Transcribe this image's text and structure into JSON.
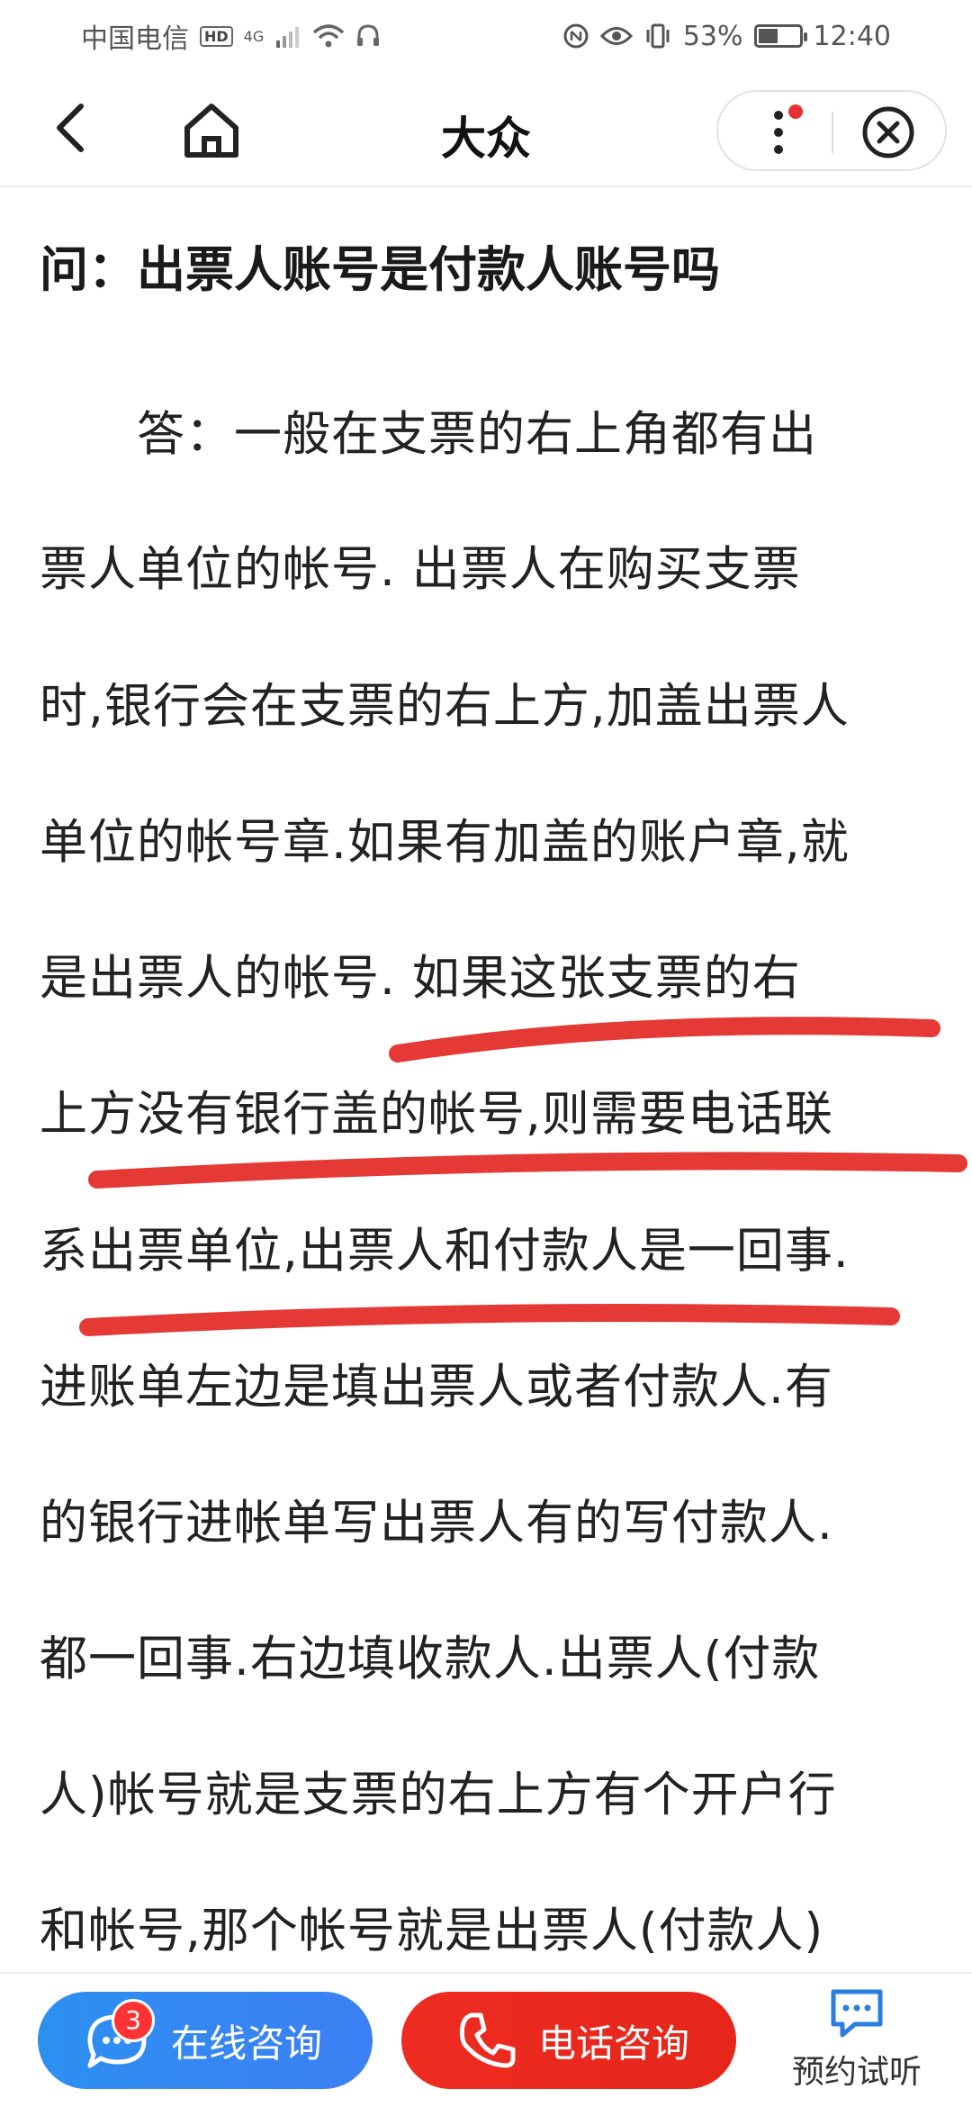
{
  "status_bar": {
    "carrier": "中国电信",
    "hd_badge": "HD",
    "network": "4G",
    "battery": "53%",
    "battery_level": 0.53,
    "time": "12:40"
  },
  "nav": {
    "title": "大众"
  },
  "article": {
    "question": "问：出票人账号是付款人账号吗",
    "answer_lines": [
      "　　答：一般在支票的右上角都有出",
      "票人单位的帐号. 出票人在购买支票",
      "时,银行会在支票的右上方,加盖出票人",
      "单位的帐号章.如果有加盖的账户章,就",
      "是出票人的帐号. 如果这张支票的右",
      "上方没有银行盖的帐号,则需要电话联",
      "系出票单位,出票人和付款人是一回事.",
      "进账单左边是填出票人或者付款人.有",
      "的银行进帐单写出票人有的写付款人.",
      "都一回事.右边填收款人.出票人(付款",
      "人)帐号就是支票的右上方有个开户行",
      "和帐号,那个帐号就是出票人(付款人)"
    ]
  },
  "bottom": {
    "online_label": "在线咨询",
    "online_badge": "3",
    "phone_label": "电话咨询",
    "trial_label": "预约试听"
  },
  "colors": {
    "online_button": "#2c90f0",
    "phone_button": "#e6261b",
    "underline": "#e53935"
  }
}
